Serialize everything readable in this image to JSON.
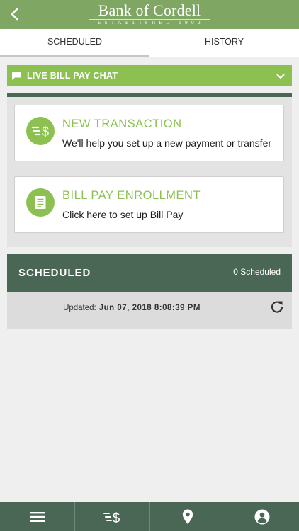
{
  "header": {
    "logo_name": "Bank of Cordell",
    "logo_sub": "ESTABLISHED 1902"
  },
  "tabs": [
    {
      "label": "SCHEDULED",
      "active": true
    },
    {
      "label": "HISTORY",
      "active": false
    }
  ],
  "chat": {
    "label": "LIVE BILL PAY CHAT",
    "icon": "chat-bubble-icon"
  },
  "cards": [
    {
      "title": "NEW TRANSACTION",
      "description": "We'll help you set up a new payment or transfer",
      "icon": "money-transfer-icon"
    },
    {
      "title": "BILL PAY ENROLLMENT",
      "description": "Click here to set up Bill Pay",
      "icon": "document-icon"
    }
  ],
  "scheduled": {
    "title": "SCHEDULED",
    "count_label": "0 Scheduled",
    "updated_label": "Updated:",
    "updated_value": "Jun 07, 2018 8:08:39 PM"
  },
  "bottom_nav": [
    {
      "icon": "menu-icon"
    },
    {
      "icon": "money-transfer-icon"
    },
    {
      "icon": "location-pin-icon"
    },
    {
      "icon": "account-icon"
    }
  ],
  "colors": {
    "header_green": "#7fa763",
    "accent_green": "#8cc152",
    "dark_green": "#4a6655"
  }
}
